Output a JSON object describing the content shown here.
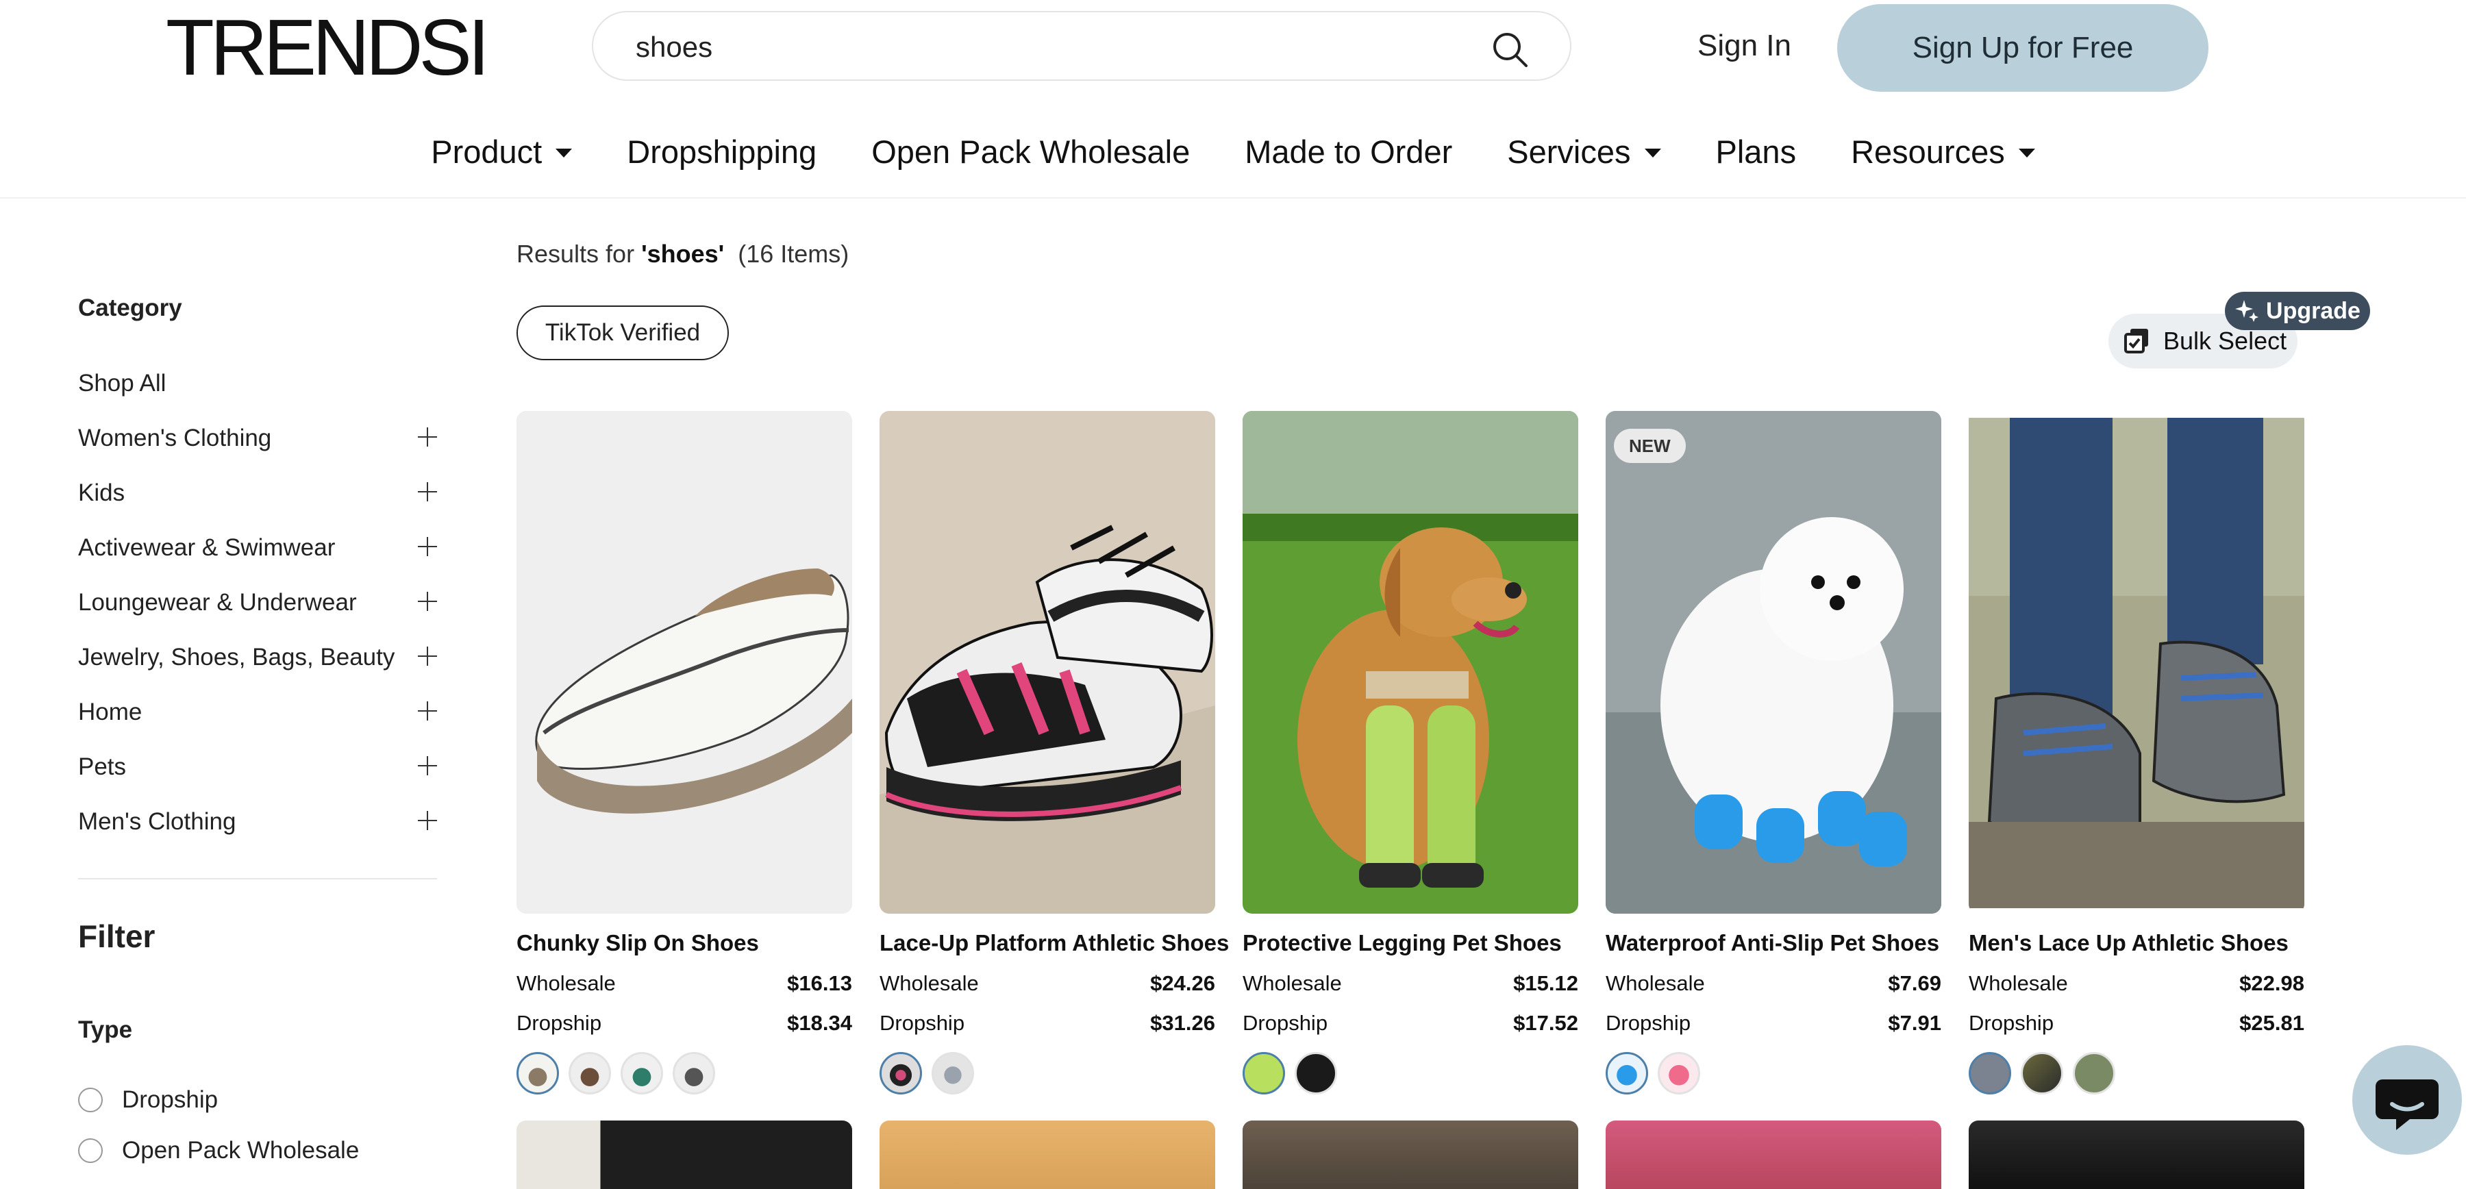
{
  "header": {
    "logo": "TRENDSI",
    "search_value": "shoes",
    "sign_in": "Sign In",
    "sign_up": "Sign Up for Free"
  },
  "nav": {
    "product": "Product",
    "dropshipping": "Dropshipping",
    "open_pack": "Open Pack Wholesale",
    "made_to_order": "Made to Order",
    "services": "Services",
    "plans": "Plans",
    "resources": "Resources"
  },
  "sidebar": {
    "category_heading": "Category",
    "items": [
      {
        "label": "Shop All"
      },
      {
        "label": "Women's Clothing"
      },
      {
        "label": "Kids"
      },
      {
        "label": "Activewear & Swimwear"
      },
      {
        "label": "Loungewear & Underwear"
      },
      {
        "label": "Jewelry, Shoes, Bags, Beauty"
      },
      {
        "label": "Home"
      },
      {
        "label": "Pets"
      },
      {
        "label": "Men's Clothing"
      }
    ],
    "filter_heading": "Filter",
    "type_heading": "Type",
    "type_options": [
      "Dropship",
      "Open Pack Wholesale"
    ]
  },
  "results": {
    "prefix": "Results for ",
    "query": "'shoes'",
    "count": "(16 Items)",
    "chip": "TikTok Verified",
    "bulk_select": "Bulk Select",
    "upgrade": "Upgrade"
  },
  "price_labels": {
    "wholesale": "Wholesale",
    "dropship": "Dropship"
  },
  "products": [
    {
      "name": "Chunky Slip On Shoes",
      "wholesale": "$16.13",
      "dropship": "$18.34"
    },
    {
      "name": "Lace-Up Platform Athletic Shoes",
      "wholesale": "$24.26",
      "dropship": "$31.26"
    },
    {
      "name": "Protective Legging Pet Shoes",
      "wholesale": "$15.12",
      "dropship": "$17.52"
    },
    {
      "name": "Waterproof Anti-Slip Pet Shoes",
      "wholesale": "$7.69",
      "dropship": "$7.91",
      "badge": "NEW"
    },
    {
      "name": "Men's Lace Up Athletic Shoes",
      "wholesale": "$22.98",
      "dropship": "$25.81"
    }
  ],
  "colors": {
    "signup_bg": "#b9cfd9",
    "upgrade_bg": "#3d4d5e",
    "selected_swatch": "#4d7fa8"
  }
}
